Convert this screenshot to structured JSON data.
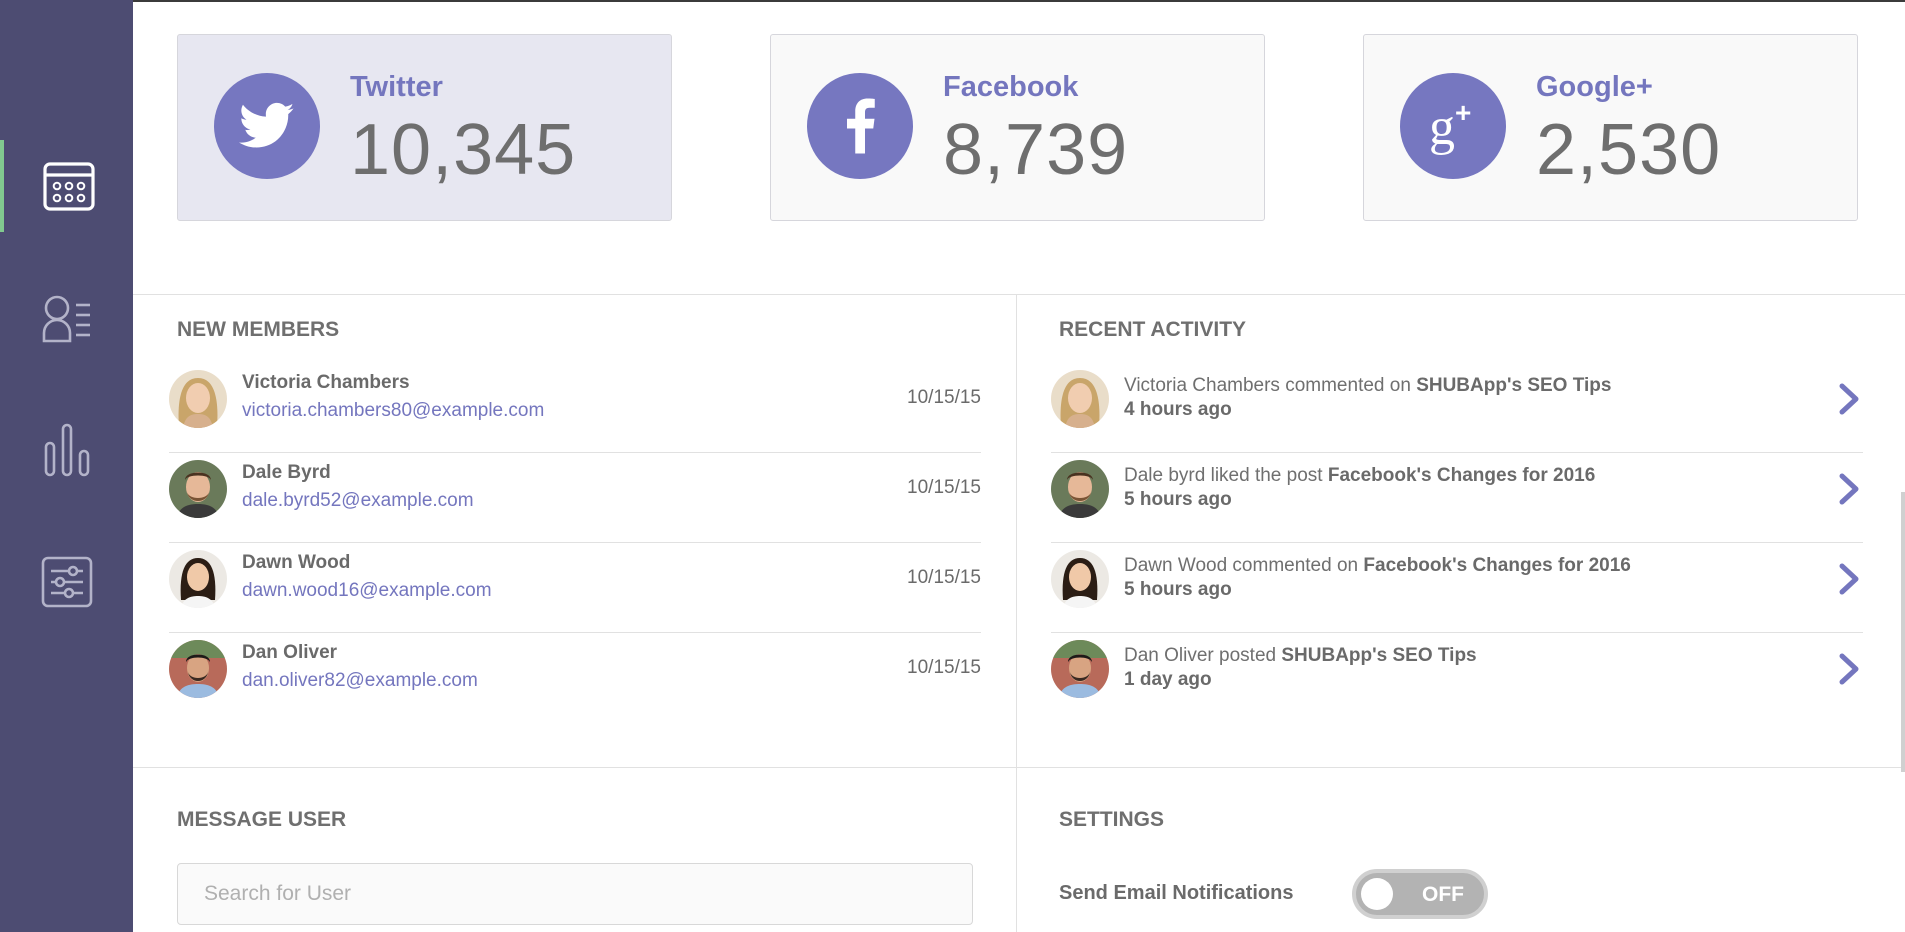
{
  "colors": {
    "sidebar": "#4d4c72",
    "accent": "#7476be",
    "active_indicator": "#81c98f"
  },
  "sidebar": {
    "items": [
      {
        "icon": "calendar-icon",
        "active": true
      },
      {
        "icon": "users-list-icon",
        "active": false
      },
      {
        "icon": "bar-chart-icon",
        "active": false
      },
      {
        "icon": "sliders-icon",
        "active": false
      }
    ]
  },
  "social": [
    {
      "icon": "twitter-icon",
      "label": "Twitter",
      "count": "10,345"
    },
    {
      "icon": "facebook-icon",
      "label": "Facebook",
      "count": "8,739"
    },
    {
      "icon": "google-plus-icon",
      "label": "Google+",
      "count": "2,530"
    }
  ],
  "new_members": {
    "title": "NEW MEMBERS",
    "rows": [
      {
        "name": "Victoria Chambers",
        "email": "victoria.chambers80@example.com",
        "date": "10/15/15"
      },
      {
        "name": "Dale Byrd",
        "email": "dale.byrd52@example.com",
        "date": "10/15/15"
      },
      {
        "name": "Dawn Wood",
        "email": "dawn.wood16@example.com",
        "date": "10/15/15"
      },
      {
        "name": "Dan Oliver",
        "email": "dan.oliver82@example.com",
        "date": "10/15/15"
      }
    ]
  },
  "recent_activity": {
    "title": "RECENT ACTIVITY",
    "rows": [
      {
        "text": "Victoria Chambers commented on",
        "ref": "SHUBApp's SEO Tips",
        "time": "4 hours ago"
      },
      {
        "text": "Dale byrd liked the post",
        "ref": "Facebook's Changes for 2016",
        "time": "5 hours ago"
      },
      {
        "text": "Dawn Wood commented on",
        "ref": "Facebook's Changes for 2016",
        "time": "5 hours ago"
      },
      {
        "text": "Dan Oliver posted",
        "ref": "SHUBApp's SEO Tips",
        "time": "1 day ago"
      }
    ]
  },
  "message_user": {
    "title": "MESSAGE USER",
    "placeholder": "Search for User"
  },
  "settings": {
    "title": "SETTINGS",
    "email_label": "Send Email Notifications",
    "toggle_state": "OFF"
  }
}
